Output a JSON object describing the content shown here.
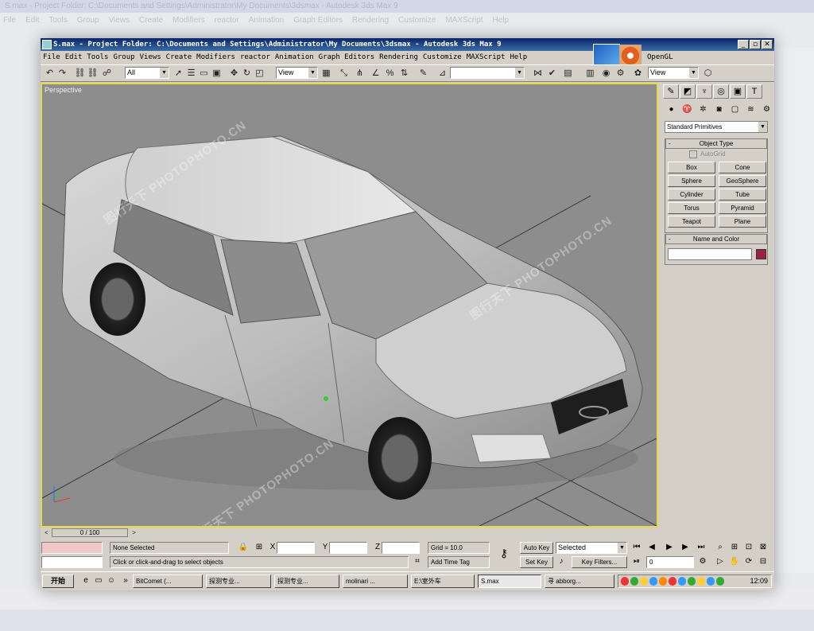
{
  "window": {
    "title": "S.max  - Project Folder: C:\\Documents and Settings\\Administrator\\My Documents\\3dsmax  - Autodesk 3ds Max 9",
    "buttons": {
      "minimize": "_",
      "restore": "▫",
      "close": "✕"
    }
  },
  "menu": {
    "items": [
      "File",
      "Edit",
      "Tools",
      "Group",
      "Views",
      "Create",
      "Modifiers",
      "reactor",
      "Animation",
      "Graph Editors",
      "Rendering",
      "Customize",
      "MAXScript",
      "Help"
    ],
    "renderer": "OpenGL"
  },
  "toolbar": {
    "selection_filter": "All",
    "reference_coord": "View",
    "named_selection": "",
    "render_view": "View"
  },
  "viewport": {
    "label": "Perspective",
    "watermark": "图行天下 PHOTOPHOTO.CN"
  },
  "command_panel": {
    "category": "Standard Primitives",
    "object_type_title": "Object Type",
    "autogrid": "AutoGrid",
    "primitives": [
      "Box",
      "Cone",
      "Sphere",
      "GeoSphere",
      "Cylinder",
      "Tube",
      "Torus",
      "Pyramid",
      "Teapot",
      "Plane"
    ],
    "name_color_title": "Name and Color",
    "object_color": "#a02040"
  },
  "timeline": {
    "frame": "0 / 100"
  },
  "status": {
    "selection": "None Selected",
    "prompt": "Click or click-and-drag to select objects",
    "x_label": "X",
    "y_label": "Y",
    "z_label": "Z",
    "grid": "Grid = 10.0",
    "add_time_tag": "Add Time Tag",
    "auto_key": "Auto Key",
    "set_key": "Set Key",
    "key_mode": "Selected",
    "key_filters": "Key Filters...",
    "frame_value": "0"
  },
  "taskbar": {
    "start": "开始",
    "tasks": [
      "BitComet (...",
      "探测专业...",
      "探测专业...",
      "molinari ...",
      "E:\\室外车",
      "S.max",
      "寻 abborg..."
    ],
    "active_task": 5,
    "clock": "12:09"
  },
  "background": {
    "title": "S.max  - Project Folder: C:\\Documents and Settings\\Administrator\\My Documents\\3dsmax  - Autodesk 3ds Max 9",
    "status": "Click or click-and-drag to select objects"
  }
}
